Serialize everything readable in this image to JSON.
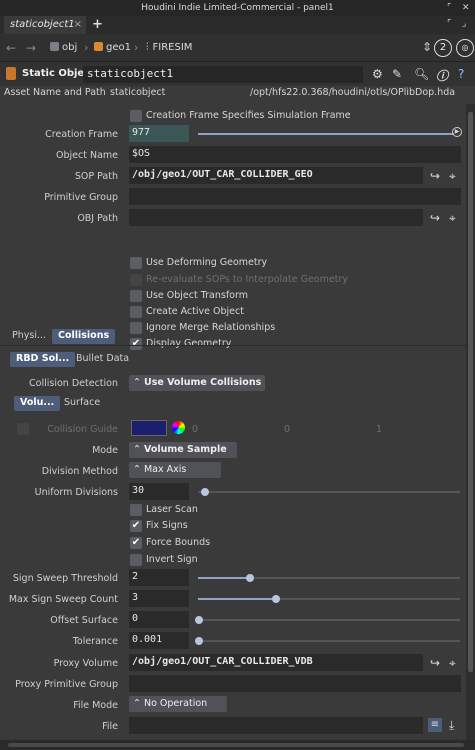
{
  "window": {
    "title": "Houdini Indie Limited-Commercial - panel1"
  },
  "tab": {
    "label": "staticobject1",
    "close": "×",
    "add": "+"
  },
  "path": {
    "crumbs": [
      "obj",
      "geo1",
      "FIRESIM"
    ],
    "pane_number": "2"
  },
  "node": {
    "type_label": "Static Object",
    "name": "staticobject1"
  },
  "asset": {
    "label": "Asset Name and Path",
    "name": "staticobject",
    "path": "/opt/hfs22.0.368/houdini/otls/OPlibDop.hda"
  },
  "params": {
    "creation_frame_specifies": "Creation Frame Specifies Simulation Frame",
    "creation_frame_label": "Creation Frame",
    "creation_frame_value": "977",
    "object_name_label": "Object Name",
    "object_name_value": "$OS",
    "sop_path_label": "SOP Path",
    "sop_path_value": "/obj/geo1/OUT_CAR_COLLIDER_GEO",
    "primitive_group_label": "Primitive Group",
    "obj_path_label": "OBJ Path",
    "use_deforming": "Use Deforming Geometry",
    "reevaluate": "Re-evaluate SOPs to Interpolate Geometry",
    "use_transform": "Use Object Transform",
    "create_active": "Create Active Object",
    "ignore_merge": "Ignore Merge Relationships",
    "display_geometry": "Display Geometry"
  },
  "tabs_main": [
    "Physi...",
    "Collisions"
  ],
  "tabs_rbd": [
    "RBD Sol...",
    "Bullet Data"
  ],
  "collision": {
    "detection_label": "Collision Detection",
    "detection_value": "Use Volume Collisions"
  },
  "tabs_volume": [
    "Volu...",
    "Surface"
  ],
  "volume": {
    "guide_label": "Collision Guide",
    "guide_values": [
      "0",
      "0",
      "1"
    ],
    "guide_color": "#1c1f6e",
    "mode_label": "Mode",
    "mode_value": "Volume Sample",
    "division_label": "Division Method",
    "division_value": "Max Axis",
    "uniform_label": "Uniform Divisions",
    "uniform_value": "30",
    "laser_scan": "Laser Scan",
    "fix_signs": "Fix Signs",
    "force_bounds": "Force Bounds",
    "invert_sign": "Invert Sign",
    "sweep_threshold_label": "Sign Sweep Threshold",
    "sweep_threshold_value": "2",
    "sweep_count_label": "Max Sign Sweep Count",
    "sweep_count_value": "3",
    "offset_label": "Offset Surface",
    "offset_value": "0",
    "tolerance_label": "Tolerance",
    "tolerance_value": "0.001",
    "proxy_volume_label": "Proxy Volume",
    "proxy_volume_value": "/obj/geo1/OUT_CAR_COLLIDER_VDB",
    "proxy_group_label": "Proxy Primitive Group",
    "file_mode_label": "File Mode",
    "file_mode_value": "No Operation",
    "file_label": "File"
  },
  "colors": {
    "accent": "#4e5d7a",
    "slider": "#8ea3c6",
    "field_highlight": "#3b5656"
  }
}
